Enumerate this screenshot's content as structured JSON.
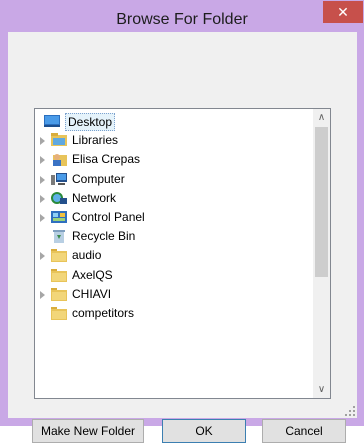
{
  "window": {
    "title": "Browse For Folder",
    "close_glyph": "✕"
  },
  "tree": {
    "items": [
      {
        "label": "Desktop",
        "icon": "desktop-icon",
        "expandable": false,
        "selected": true,
        "indent": 0
      },
      {
        "label": "Libraries",
        "icon": "libraries-icon",
        "expandable": true,
        "selected": false,
        "indent": 1
      },
      {
        "label": "Elisa Crepas",
        "icon": "user-folder-icon",
        "expandable": true,
        "selected": false,
        "indent": 1
      },
      {
        "label": "Computer",
        "icon": "computer-icon",
        "expandable": true,
        "selected": false,
        "indent": 1
      },
      {
        "label": "Network",
        "icon": "network-icon",
        "expandable": true,
        "selected": false,
        "indent": 1
      },
      {
        "label": "Control Panel",
        "icon": "control-panel-icon",
        "expandable": true,
        "selected": false,
        "indent": 1
      },
      {
        "label": "Recycle Bin",
        "icon": "recycle-bin-icon",
        "expandable": false,
        "selected": false,
        "indent": 1
      },
      {
        "label": "audio",
        "icon": "folder-icon",
        "expandable": true,
        "selected": false,
        "indent": 1
      },
      {
        "label": "AxelQS",
        "icon": "folder-icon",
        "expandable": false,
        "selected": false,
        "indent": 1
      },
      {
        "label": "CHIAVI",
        "icon": "folder-icon",
        "expandable": true,
        "selected": false,
        "indent": 1
      },
      {
        "label": "competitors",
        "icon": "folder-icon",
        "expandable": false,
        "selected": false,
        "indent": 1
      }
    ]
  },
  "buttons": {
    "new_folder": "Make New Folder",
    "ok": "OK",
    "cancel": "Cancel"
  },
  "scrollbar": {
    "up_glyph": "∧",
    "down_glyph": "∨"
  },
  "colors": {
    "title_bar": "#c9a8e6",
    "close_button": "#c7504b",
    "selection": "#e5f3fb"
  }
}
